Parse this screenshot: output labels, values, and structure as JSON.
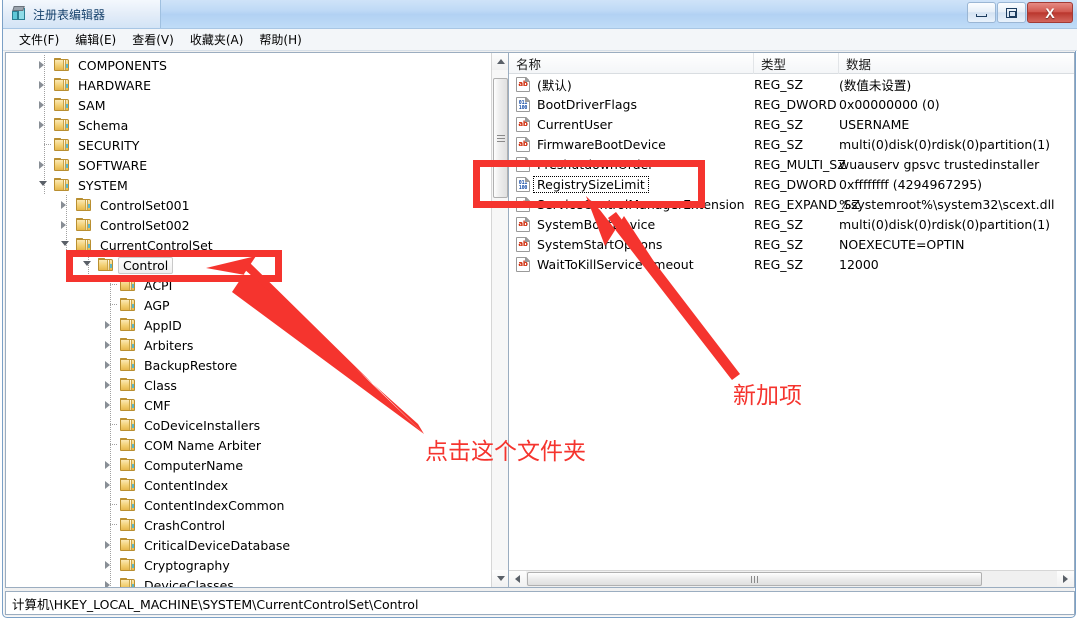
{
  "window": {
    "title": "注册表编辑器",
    "app_icon": "registry-editor-icon",
    "buttons": {
      "minimize": "最小化",
      "maximize": "最大化",
      "close": "关闭",
      "close_glyph": "X"
    }
  },
  "menu": {
    "items": [
      {
        "label": "文件(F)",
        "name": "menu-file"
      },
      {
        "label": "编辑(E)",
        "name": "menu-edit"
      },
      {
        "label": "查看(V)",
        "name": "menu-view"
      },
      {
        "label": "收藏夹(A)",
        "name": "menu-favorites"
      },
      {
        "label": "帮助(H)",
        "name": "menu-help"
      }
    ]
  },
  "tree": {
    "nodes": [
      {
        "label": "COMPONENTS",
        "indent": 1,
        "state": "collapsed",
        "selected": false
      },
      {
        "label": "HARDWARE",
        "indent": 1,
        "state": "collapsed",
        "selected": false
      },
      {
        "label": "SAM",
        "indent": 1,
        "state": "collapsed",
        "selected": false
      },
      {
        "label": "Schema",
        "indent": 1,
        "state": "collapsed",
        "selected": false
      },
      {
        "label": "SECURITY",
        "indent": 1,
        "state": "leaf",
        "selected": false
      },
      {
        "label": "SOFTWARE",
        "indent": 1,
        "state": "collapsed",
        "selected": false
      },
      {
        "label": "SYSTEM",
        "indent": 1,
        "state": "expanded",
        "selected": false
      },
      {
        "label": "ControlSet001",
        "indent": 2,
        "state": "collapsed",
        "selected": false
      },
      {
        "label": "ControlSet002",
        "indent": 2,
        "state": "collapsed",
        "selected": false
      },
      {
        "label": "CurrentControlSet",
        "indent": 2,
        "state": "expanded",
        "selected": false
      },
      {
        "label": "Control",
        "indent": 3,
        "state": "expanded",
        "selected": true
      },
      {
        "label": "ACPI",
        "indent": 4,
        "state": "leaf",
        "selected": false
      },
      {
        "label": "AGP",
        "indent": 4,
        "state": "leaf",
        "selected": false
      },
      {
        "label": "AppID",
        "indent": 4,
        "state": "collapsed",
        "selected": false
      },
      {
        "label": "Arbiters",
        "indent": 4,
        "state": "collapsed",
        "selected": false
      },
      {
        "label": "BackupRestore",
        "indent": 4,
        "state": "collapsed",
        "selected": false
      },
      {
        "label": "Class",
        "indent": 4,
        "state": "collapsed",
        "selected": false
      },
      {
        "label": "CMF",
        "indent": 4,
        "state": "collapsed",
        "selected": false
      },
      {
        "label": "CoDeviceInstallers",
        "indent": 4,
        "state": "leaf",
        "selected": false
      },
      {
        "label": "COM Name Arbiter",
        "indent": 4,
        "state": "leaf",
        "selected": false
      },
      {
        "label": "ComputerName",
        "indent": 4,
        "state": "collapsed",
        "selected": false
      },
      {
        "label": "ContentIndex",
        "indent": 4,
        "state": "collapsed",
        "selected": false
      },
      {
        "label": "ContentIndexCommon",
        "indent": 4,
        "state": "leaf",
        "selected": false
      },
      {
        "label": "CrashControl",
        "indent": 4,
        "state": "leaf",
        "selected": false
      },
      {
        "label": "CriticalDeviceDatabase",
        "indent": 4,
        "state": "collapsed",
        "selected": false
      },
      {
        "label": "Cryptography",
        "indent": 4,
        "state": "collapsed",
        "selected": false
      },
      {
        "label": "DeviceClasses",
        "indent": 4,
        "state": "collapsed",
        "selected": false
      }
    ],
    "scrollbar": {
      "up_arrow": "scroll-up",
      "down_arrow": "scroll-down",
      "thumb": "tree-scroll-thumb"
    }
  },
  "list": {
    "columns": [
      "名称",
      "类型",
      "数据"
    ],
    "rows": [
      {
        "name": "(默认)",
        "icon": "string-value-icon",
        "type": "REG_SZ",
        "data": "(数值未设置)",
        "focused": false,
        "obscured": false
      },
      {
        "name": "BootDriverFlags",
        "icon": "dword-value-icon",
        "type": "REG_DWORD",
        "data": "0x00000000 (0)",
        "focused": false,
        "obscured": false
      },
      {
        "name": "CurrentUser",
        "icon": "string-value-icon",
        "type": "REG_SZ",
        "data": "USERNAME",
        "focused": false,
        "obscured": false
      },
      {
        "name": "FirmwareBootDevice",
        "icon": "string-value-icon",
        "type": "REG_SZ",
        "data": "multi(0)disk(0)rdisk(0)partition(1)",
        "focused": false,
        "obscured": false
      },
      {
        "name": "PreshutdownOrder",
        "icon": "string-value-icon",
        "type": "REG_MULTI_SZ",
        "data": "wuauserv gpsvc trustedinstaller",
        "focused": false,
        "obscured": true
      },
      {
        "name": "RegistrySizeLimit",
        "icon": "dword-value-icon",
        "type": "REG_DWORD",
        "data": "0xffffffff (4294967295)",
        "focused": true,
        "obscured": false
      },
      {
        "name": "ServiceControlManagerExtension",
        "icon": "string-value-icon",
        "type": "REG_EXPAND_SZ",
        "data": "%systemroot%\\system32\\scext.dll",
        "focused": false,
        "obscured": true
      },
      {
        "name": "SystemBootDevice",
        "icon": "string-value-icon",
        "type": "REG_SZ",
        "data": "multi(0)disk(0)rdisk(0)partition(1)",
        "focused": false,
        "obscured": false
      },
      {
        "name": "SystemStartOptions",
        "icon": "string-value-icon",
        "type": "REG_SZ",
        "data": " NOEXECUTE=OPTIN",
        "focused": false,
        "obscured": false
      },
      {
        "name": "WaitToKillServiceTimeout",
        "icon": "string-value-icon",
        "type": "REG_SZ",
        "data": "12000",
        "focused": false,
        "obscured": false
      }
    ],
    "scrollbar": {
      "left_arrow": "scroll-left",
      "right_arrow": "scroll-right",
      "thumb": "list-hscroll-thumb"
    }
  },
  "statusbar": {
    "path": "计算机\\HKEY_LOCAL_MACHINE\\SYSTEM\\CurrentControlSet\\Control"
  },
  "annotations": {
    "color": "#f5342e",
    "click_folder_text": "点击这个文件夹",
    "new_item_text": "新加项"
  },
  "icons": {
    "string_value_label": "ab",
    "dword_value_top": "011",
    "dword_value_bottom": "100"
  }
}
